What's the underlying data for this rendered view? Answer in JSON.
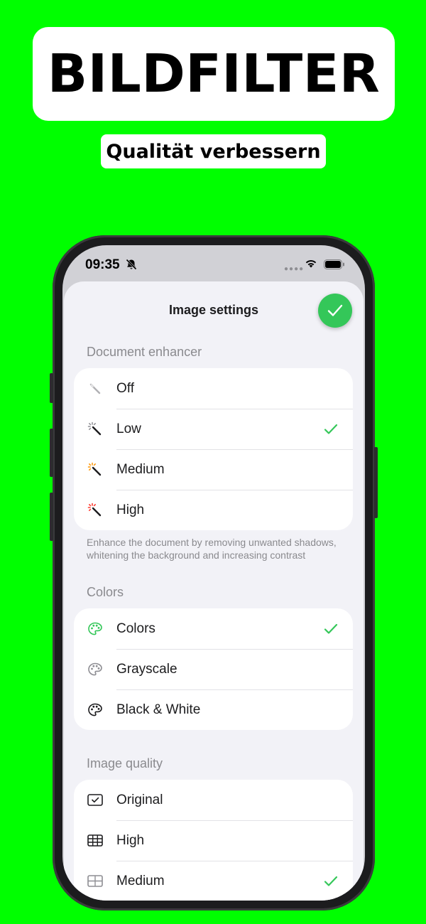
{
  "banner": {
    "title": "BILDFILTER",
    "subtitle": "Qualität verbessern"
  },
  "status_bar": {
    "time": "09:35",
    "icons": [
      "bell-slash-icon",
      "signal-dots-icon",
      "wifi-icon",
      "battery-icon"
    ]
  },
  "sheet": {
    "title": "Image settings",
    "done_icon": "checkmark-icon"
  },
  "enhancer": {
    "header": "Document enhancer",
    "footer": "Enhance the document by removing unwanted shadows, whitening the background and increasing contrast",
    "items": [
      {
        "label": "Off",
        "icon": "magic-wand-off-icon",
        "selected": false
      },
      {
        "label": "Low",
        "icon": "magic-wand-low-icon",
        "selected": true
      },
      {
        "label": "Medium",
        "icon": "magic-wand-medium-icon",
        "selected": false
      },
      {
        "label": "High",
        "icon": "magic-wand-high-icon",
        "selected": false
      }
    ]
  },
  "colors": {
    "header": "Colors",
    "items": [
      {
        "label": "Colors",
        "icon": "palette-color-icon",
        "selected": true
      },
      {
        "label": "Grayscale",
        "icon": "palette-gray-icon",
        "selected": false
      },
      {
        "label": "Black & White",
        "icon": "palette-bw-icon",
        "selected": false
      }
    ]
  },
  "quality": {
    "header": "Image quality",
    "items": [
      {
        "label": "Original",
        "icon": "original-square-icon",
        "selected": false
      },
      {
        "label": "High",
        "icon": "grid-high-icon",
        "selected": false
      },
      {
        "label": "Medium",
        "icon": "grid-medium-icon",
        "selected": true
      }
    ]
  },
  "colors_palette": {
    "background": "#00ff00",
    "accent": "#34c759",
    "wand_medium_sparkle": "#ff9500",
    "wand_high_sparkle": "#ff3b30"
  }
}
